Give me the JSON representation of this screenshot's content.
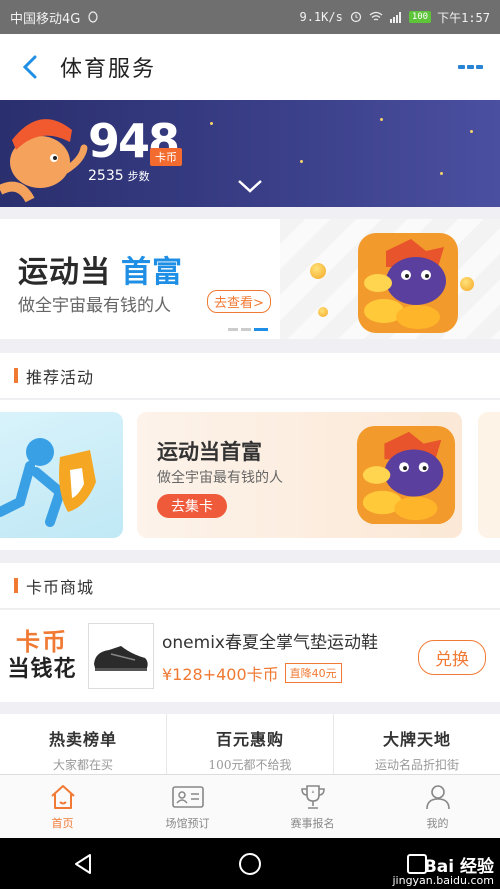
{
  "status_bar": {
    "carrier": "中国移动4G",
    "speed": "9.1K/s",
    "battery": "100",
    "time": "下午1:57"
  },
  "nav": {
    "title": "体育服务"
  },
  "hero": {
    "coins": "948",
    "coin_unit": "卡币",
    "steps": "2535",
    "steps_unit": "步数"
  },
  "promo": {
    "title_part1": "运动当",
    "title_part2": "首富",
    "subtitle": "做全宇宙最有钱的人",
    "button": "去查看>"
  },
  "activities": {
    "section_title": "推荐活动",
    "card": {
      "title": "运动当首富",
      "subtitle": "做全宇宙最有钱的人",
      "button": "去集卡"
    }
  },
  "shop": {
    "section_title": "卡币商城",
    "logo_line1": "卡币",
    "logo_line2": "当钱花",
    "product_name": "onemix春夏全掌气垫运动鞋",
    "price": "¥128+400卡币",
    "discount": "直降40元",
    "redeem_button": "兑换"
  },
  "categories": [
    {
      "title": "热卖榜单",
      "subtitle": "大家都在买"
    },
    {
      "title": "百元惠购",
      "subtitle": "100元都不给我"
    },
    {
      "title": "大牌天地",
      "subtitle": "运动名品折扣街"
    }
  ],
  "tabs": [
    {
      "label": "首页",
      "icon": "home-icon",
      "active": true
    },
    {
      "label": "场馆预订",
      "icon": "id-card-icon",
      "active": false
    },
    {
      "label": "赛事报名",
      "icon": "trophy-icon",
      "active": false
    },
    {
      "label": "我的",
      "icon": "user-icon",
      "active": false
    }
  ],
  "watermark": {
    "line1": "Bai 经验",
    "line2": "jingyan.baidu.com"
  },
  "colors": {
    "accent": "#f07a34",
    "link_blue": "#1f8fe6",
    "hero_bg": "#2a2f6e"
  }
}
